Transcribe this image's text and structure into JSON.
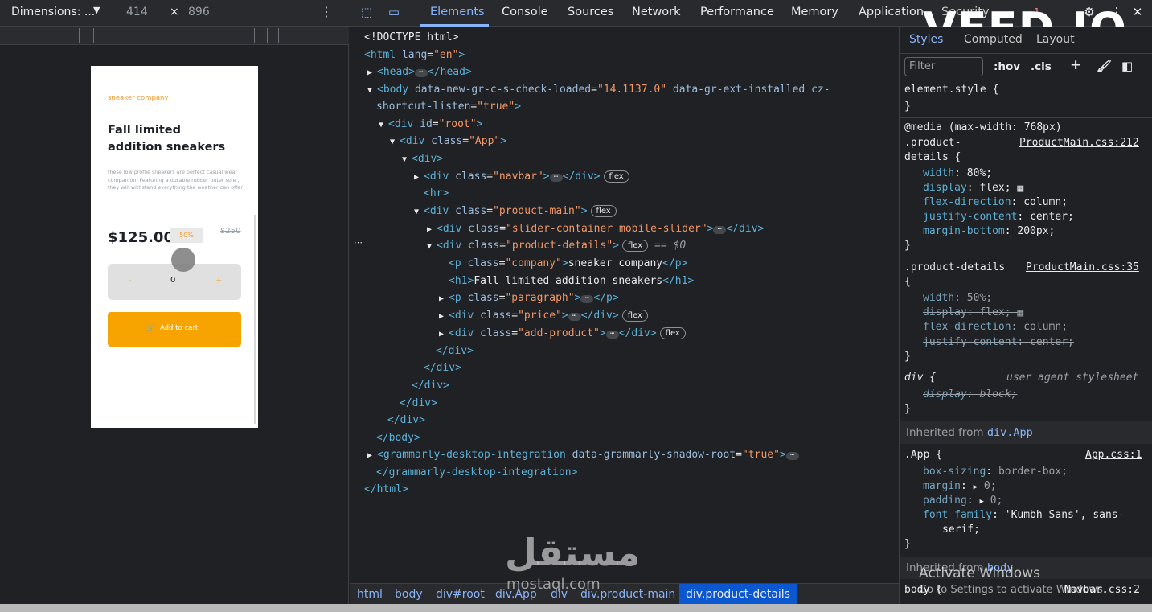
{
  "device_toolbar": {
    "dimensions_label": "Dimensions: ...",
    "width": "414",
    "times": "×",
    "height": "896",
    "more_icon": "kebab-icon"
  },
  "devtools_tabs": [
    "Elements",
    "Console",
    "Sources",
    "Network",
    "Performance",
    "Memory",
    "Application",
    "Security"
  ],
  "active_tab": "Elements",
  "error_count": "1",
  "overlay_text": "VEED.IO",
  "preview": {
    "company": "sneaker company",
    "title": "Fall limited addition sneakers",
    "paragraph": "these low profile sneakers are perfect casual wear companion. Featuring a durable rubber outer sole , they will withstand everything the weather can offer",
    "price": "$125.00",
    "discount": "50%",
    "old_price": "$250",
    "minus": "-",
    "quantity": "0",
    "plus": "+",
    "add_to_cart": "Add to cart",
    "cart_icon": "🛒"
  },
  "dom_tree": {
    "doctype": "<!DOCTYPE html>",
    "html_open": "<html",
    "lang_attr": "lang",
    "lang_val": "\"en\"",
    "head_open": "<head>",
    "head_close": "</head>",
    "body_open": "<body",
    "body_attr1": "data-new-gr-c-s-check-loaded",
    "body_val1": "\"14.1137.0\"",
    "body_attr2": "data-gr-ext-installed",
    "body_attr3": "cz-",
    "body_attr3b": "shortcut-listen",
    "body_val3": "\"true\"",
    "div_open": "<div",
    "id_attr": "id",
    "root_val": "\"root\"",
    "class_attr": "class",
    "app_val": "\"App\"",
    "div_plain": "<div>",
    "navbar_val": "\"navbar\"",
    "hr": "<hr>",
    "product_main_val": "\"product-main\"",
    "slider_val": "\"slider-container mobile-slider\"",
    "product_details_val": "\"product-details\"",
    "dollar0": "== $0",
    "p_open": "<p",
    "company_val": "\"company\"",
    "company_text": "sneaker company",
    "p_close": "</p>",
    "h1_open": "<h1>",
    "h1_text": "Fall limited addition sneakers",
    "h1_close": "</h1>",
    "paragraph_val": "\"paragraph\"",
    "price_val": "\"price\"",
    "add_product_val": "\"add-product\"",
    "div_close": "</div>",
    "body_close": "</body>",
    "grammarly_open": "<grammarly-desktop-integration",
    "grammarly_attr": "data-grammarly-shadow-root",
    "grammarly_val": "\"true\"",
    "grammarly_close": "</grammarly-desktop-integration>",
    "html_close": "</html>",
    "gt": ">",
    "eq": "=",
    "flex": "flex",
    "ellipsis": "⋯",
    "gutter": "⋯"
  },
  "breadcrumbs": [
    "html",
    "body",
    "div#root",
    "div.App",
    "div",
    "div.product-main",
    "div.product-details"
  ],
  "styles_panel": {
    "tabs": [
      "Styles",
      "Computed",
      "Layout"
    ],
    "filter_placeholder": "Filter",
    "hov": ":hov",
    "cls": ".cls",
    "element_style": "element.style {",
    "close_brace": "}",
    "media_rule": "@media (max-width: 768px)",
    "product_details_sel1": ".product-",
    "product_details_sel1b": "details {",
    "source1": "ProductMain.css:212",
    "rule1": [
      [
        "width",
        "80%;"
      ],
      [
        "display",
        "flex;"
      ],
      [
        "flex-direction",
        "column;"
      ],
      [
        "justify-content",
        "center;"
      ],
      [
        "margin-bottom",
        "200px;"
      ]
    ],
    "product_details_sel2": ".product-details",
    "source2": "ProductMain.css:35",
    "open_brace": "{",
    "rule2": [
      [
        "width",
        "50%;"
      ],
      [
        "display",
        "flex;"
      ],
      [
        "flex-direction",
        "column;"
      ],
      [
        "justify-content",
        "center;"
      ]
    ],
    "div_sel": "div {",
    "ua_label": "user agent stylesheet",
    "ua_rule": [
      "display",
      "block;"
    ],
    "inherited_app_label": "Inherited from",
    "inherited_app_cls": "div.App",
    "app_sel": ".App {",
    "app_source": "App.css:1",
    "app_rule": [
      [
        "box-sizing",
        "border-box;"
      ],
      [
        "margin",
        "0;"
      ],
      [
        "padding",
        "0;"
      ],
      [
        "font-family",
        "'Kumbh Sans', sans-"
      ]
    ],
    "serif": "serif;",
    "inherited_body_label": "Inherited from",
    "inherited_body_cls": "body",
    "body_sel": "body {",
    "body_source": "Navbar.css:2"
  },
  "watermark": {
    "arabic": "مستقل",
    "latin": "mostaql.com"
  },
  "windows_activation": {
    "line1": "Activate Windows",
    "line2": "Go to Settings to activate Windows."
  }
}
